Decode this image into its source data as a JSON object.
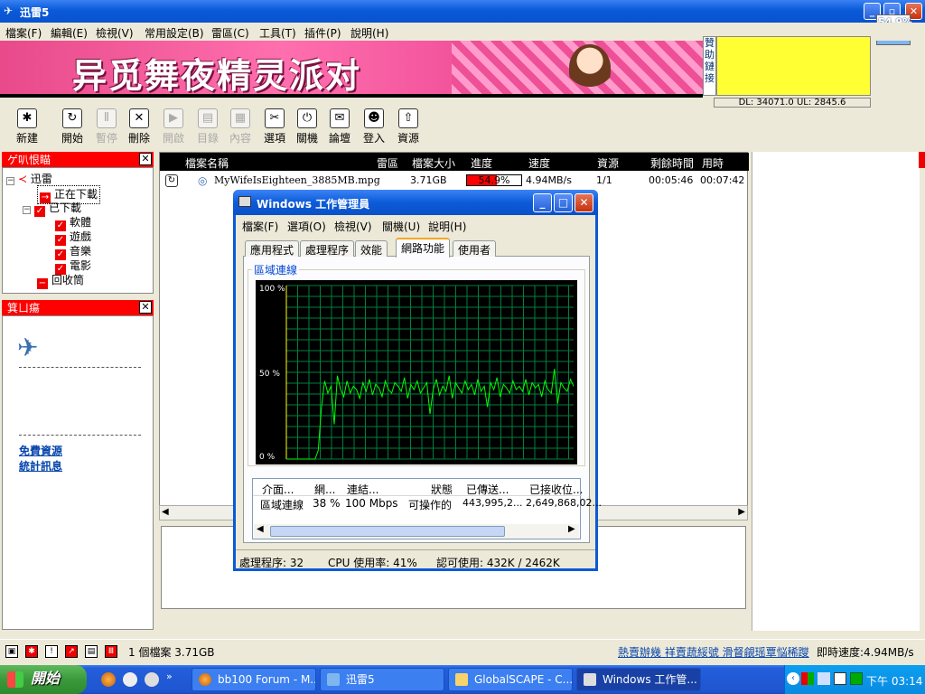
{
  "app": {
    "title": "迅雷5",
    "caption_buttons": [
      "minimize",
      "restore",
      "close"
    ],
    "speed_meter": "54.9%",
    "speed_meter_level": 0.55
  },
  "menu": [
    "檔案(F)",
    "編輯(E)",
    "檢視(V)",
    "常用設定(B)",
    "雷區(C)",
    "工具(T)",
    "插件(P)",
    "說明(H)"
  ],
  "banner": {
    "text": "异觅舞夜精灵派对",
    "sponsor": "贊助鏈接",
    "speed_line": "DL: 34071.0 UL: 2845.6"
  },
  "toolbar": [
    {
      "label": "新建",
      "icon": "new-icon",
      "glyph": "✱",
      "enabled": true
    },
    {
      "label": "開始",
      "icon": "start-icon",
      "glyph": "↻",
      "enabled": true
    },
    {
      "label": "暫停",
      "icon": "pause-icon",
      "glyph": "Ⅱ",
      "enabled": false
    },
    {
      "label": "刪除",
      "icon": "delete-icon",
      "glyph": "✕",
      "enabled": true
    },
    {
      "label": "開啟",
      "icon": "open-icon",
      "glyph": "▶",
      "enabled": false
    },
    {
      "label": "目錄",
      "icon": "folder-icon",
      "glyph": "▤",
      "enabled": false
    },
    {
      "label": "內容",
      "icon": "properties-icon",
      "glyph": "▦",
      "enabled": false
    },
    {
      "label": "選項",
      "icon": "options-icon",
      "glyph": "✂",
      "enabled": true
    },
    {
      "label": "關機",
      "icon": "shutdown-icon",
      "glyph": "⏻",
      "enabled": true
    },
    {
      "label": "論壇",
      "icon": "forum-icon",
      "glyph": "✉",
      "enabled": true
    },
    {
      "label": "登入",
      "icon": "login-icon",
      "glyph": "☻",
      "enabled": true
    },
    {
      "label": "資源",
      "icon": "resource-icon",
      "glyph": "⇧",
      "enabled": true
    }
  ],
  "left_panel": {
    "header": "ゲ叭恨瞄",
    "tree": [
      "迅雷",
      "正在下載",
      "已下載",
      "軟體",
      "遊戲",
      "音樂",
      "電影",
      "回收筒"
    ]
  },
  "left_panel2": {
    "header": "箕ㄩ瘍",
    "links": [
      "免費資源",
      "統計訊息"
    ]
  },
  "list": {
    "columns": [
      "檔案名稱",
      "雷區",
      "檔案大小",
      "進度",
      "速度",
      "資源",
      "剩餘時間",
      "用時"
    ],
    "rows": [
      {
        "name": "MyWifeIsEighteen_3885MB.mpg",
        "zone": "",
        "size": "3.71GB",
        "progress": "54.9%",
        "progress_value": 0.549,
        "speed": "4.94MB/s",
        "sources": "1/1",
        "remaining": "00:05:46",
        "elapsed": "00:07:42"
      }
    ]
  },
  "statusbar": {
    "files": "1 個檔案 3.71GB",
    "link": "熱賣辦幾 祥賣蔬綏號 滑督覦瑶覃悩稀躞",
    "speed": "即時速度:4.94MB/s"
  },
  "taskmgr": {
    "title": "Windows 工作管理員",
    "menu": [
      "檔案(F)",
      "選項(O)",
      "檢視(V)",
      "關機(U)",
      "說明(H)"
    ],
    "tabs": [
      "應用程式",
      "處理程序",
      "效能",
      "網路功能",
      "使用者"
    ],
    "active_tab": "網路功能",
    "group_label": "區域連線",
    "graph": {
      "y_labels": [
        "100 %",
        "50 %",
        "0 %"
      ],
      "line_color": "#00ff00",
      "grid_color": "#008040",
      "values": [
        0,
        0,
        0,
        0,
        0,
        0,
        0,
        0,
        0,
        0,
        5,
        30,
        45,
        38,
        42,
        20,
        48,
        40,
        36,
        45,
        38,
        42,
        40,
        35,
        44,
        39,
        46,
        37,
        43,
        41,
        36,
        45,
        40,
        38,
        44,
        42,
        39,
        47,
        35,
        43,
        40,
        45,
        38,
        41,
        44,
        26,
        40,
        46,
        37,
        42,
        39,
        48,
        35,
        44,
        41,
        38,
        45,
        40,
        43,
        37,
        46,
        39,
        42,
        30,
        44,
        40,
        47,
        36,
        43,
        41,
        38,
        45,
        40,
        42,
        39,
        46,
        37,
        44,
        41,
        43,
        36,
        45,
        40,
        38,
        52,
        32,
        44,
        41,
        39,
        46,
        42
      ]
    },
    "net_columns": [
      "介面...",
      "網...",
      "連結...",
      "狀態",
      "已傳送...",
      "已接收位..."
    ],
    "net_row": [
      "區域連線",
      "38 %",
      "100 Mbps",
      "可操作的",
      "443,995,2...",
      "2,649,868,02..."
    ],
    "status": [
      "處理程序: 32",
      "CPU 使用率: 41%",
      "認可使用: 432K / 2462K"
    ]
  },
  "taskbar": {
    "start": "開始",
    "tasks": [
      "bb100 Forum - M...",
      "迅雷5",
      "GlobalSCAPE - C...",
      "Windows 工作管..."
    ],
    "clock": "下午 03:14"
  }
}
